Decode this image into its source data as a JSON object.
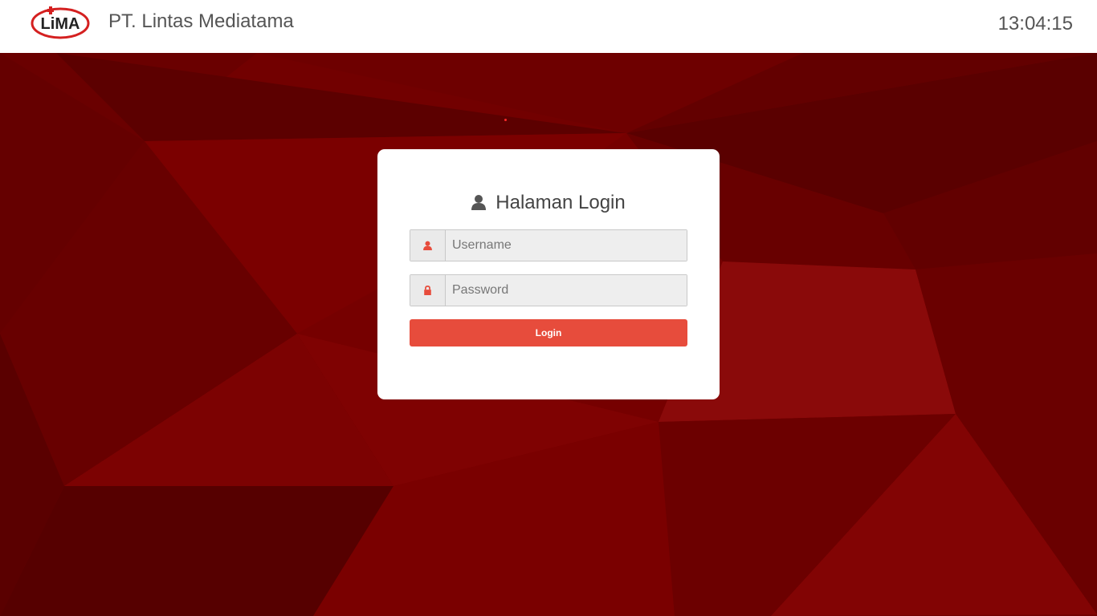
{
  "header": {
    "company_name": "PT. Lintas Mediatama",
    "clock": "13:04:15",
    "logo_text": "LiMA"
  },
  "login": {
    "title": "Halaman Login",
    "username_placeholder": "Username",
    "password_placeholder": "Password",
    "button_label": "Login"
  },
  "colors": {
    "accent": "#e74c3c",
    "background": "#7a0000",
    "logo_red": "#d42020"
  },
  "icons": {
    "title": "user-icon",
    "username": "user-icon",
    "password": "lock-icon"
  }
}
